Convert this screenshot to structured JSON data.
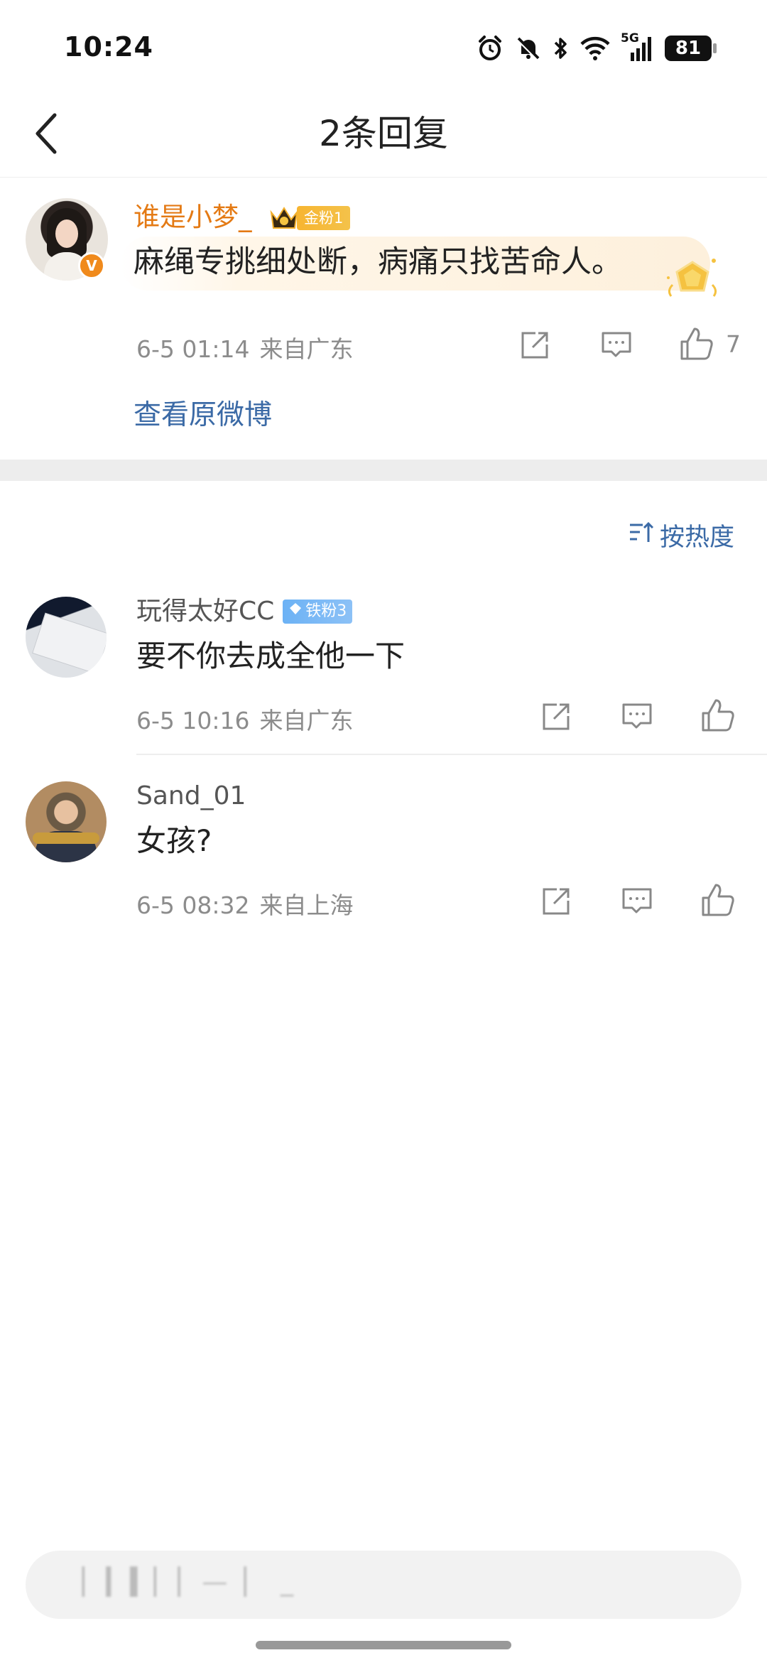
{
  "status_bar": {
    "time": "10:24",
    "network": "5G",
    "battery": "81",
    "icons": [
      "alarm-icon",
      "mute-bell-icon",
      "bluetooth-icon",
      "wifi-icon",
      "signal-icon"
    ]
  },
  "header": {
    "title": "2条回复"
  },
  "main_comment": {
    "username": "谁是小梦_",
    "fan_badge": "金粉1",
    "text": "麻绳专挑细处断，病痛只找苦命人。",
    "time": "6-5 01:14",
    "location": "来自广东",
    "like_count": "7",
    "view_original": "查看原微博",
    "username_color": "#e47a14"
  },
  "sort": {
    "label": "按热度"
  },
  "replies": [
    {
      "username": "玩得太好CC",
      "fan_badge": "铁粉3",
      "text": "要不你去成全他一下",
      "time": "6-5 10:16",
      "location": "来自广东"
    },
    {
      "username": "Sand_01",
      "text": "女孩?",
      "time": "6-5 08:32",
      "location": "来自上海"
    }
  ],
  "input": {
    "placeholder": "▏▎▍▏▏—  ▏ _"
  },
  "colors": {
    "link": "#3b6aa6",
    "meta": "#8c8c8c",
    "gold_badge": "#f7b531",
    "iron_badge": "#6cb2f5"
  }
}
